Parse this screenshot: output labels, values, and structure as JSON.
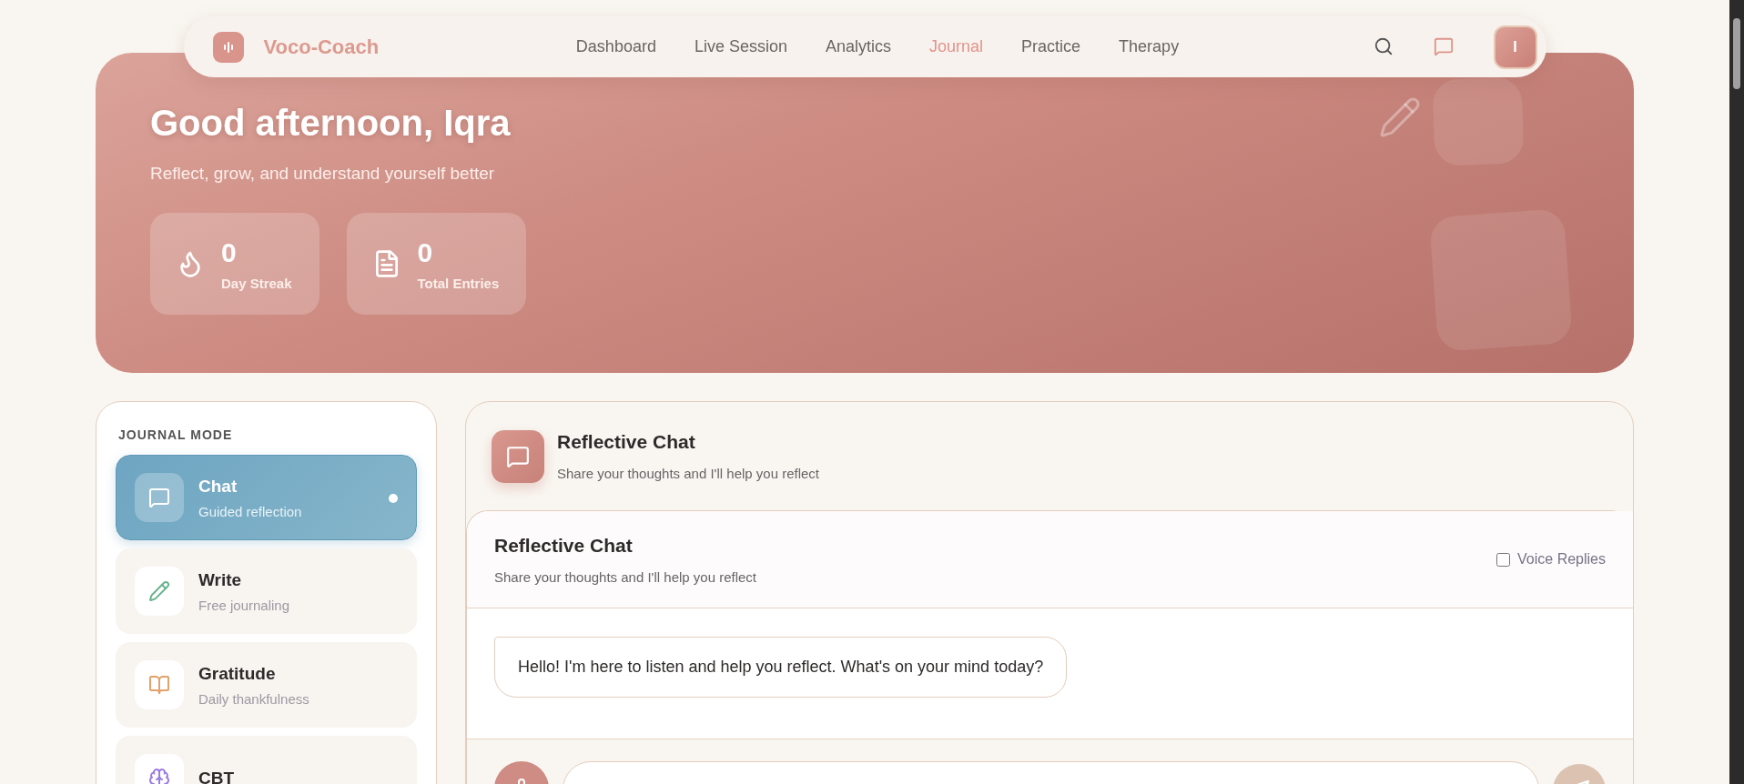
{
  "brand": {
    "name": "Voco-Coach"
  },
  "nav": [
    {
      "label": "Dashboard",
      "selected": false
    },
    {
      "label": "Live Session",
      "selected": false
    },
    {
      "label": "Analytics",
      "selected": false
    },
    {
      "label": "Journal",
      "selected": true
    },
    {
      "label": "Practice",
      "selected": false
    },
    {
      "label": "Therapy",
      "selected": false
    }
  ],
  "user": {
    "initial": "I"
  },
  "hero": {
    "greeting": "Good afternoon, Iqra",
    "subtitle": "Reflect, grow, and understand yourself better",
    "stats": [
      {
        "kind": "streak",
        "value": "0",
        "label": "Day Streak"
      },
      {
        "kind": "entries",
        "value": "0",
        "label": "Total Entries"
      }
    ]
  },
  "journal_mode": {
    "title": "JOURNAL MODE",
    "modes": [
      {
        "kind": "chat",
        "title": "Chat",
        "subtitle": "Guided reflection",
        "selected": true
      },
      {
        "kind": "write",
        "title": "Write",
        "subtitle": "Free journaling",
        "selected": false
      },
      {
        "kind": "gratitude",
        "title": "Gratitude",
        "subtitle": "Daily thankfulness",
        "selected": false
      },
      {
        "kind": "cbt",
        "title": "CBT",
        "selected": false
      }
    ]
  },
  "panel": {
    "title": "Reflective Chat",
    "subtitle": "Share your thoughts and I'll help you reflect"
  },
  "chat": {
    "title": "Reflective Chat",
    "subtitle": "Share your thoughts and I'll help you reflect",
    "voice_replies": {
      "label": "Voice Replies",
      "checked": false
    },
    "messages": [
      {
        "text": "Hello! I'm here to listen and help you reflect. What's on your mind today?"
      }
    ]
  }
}
